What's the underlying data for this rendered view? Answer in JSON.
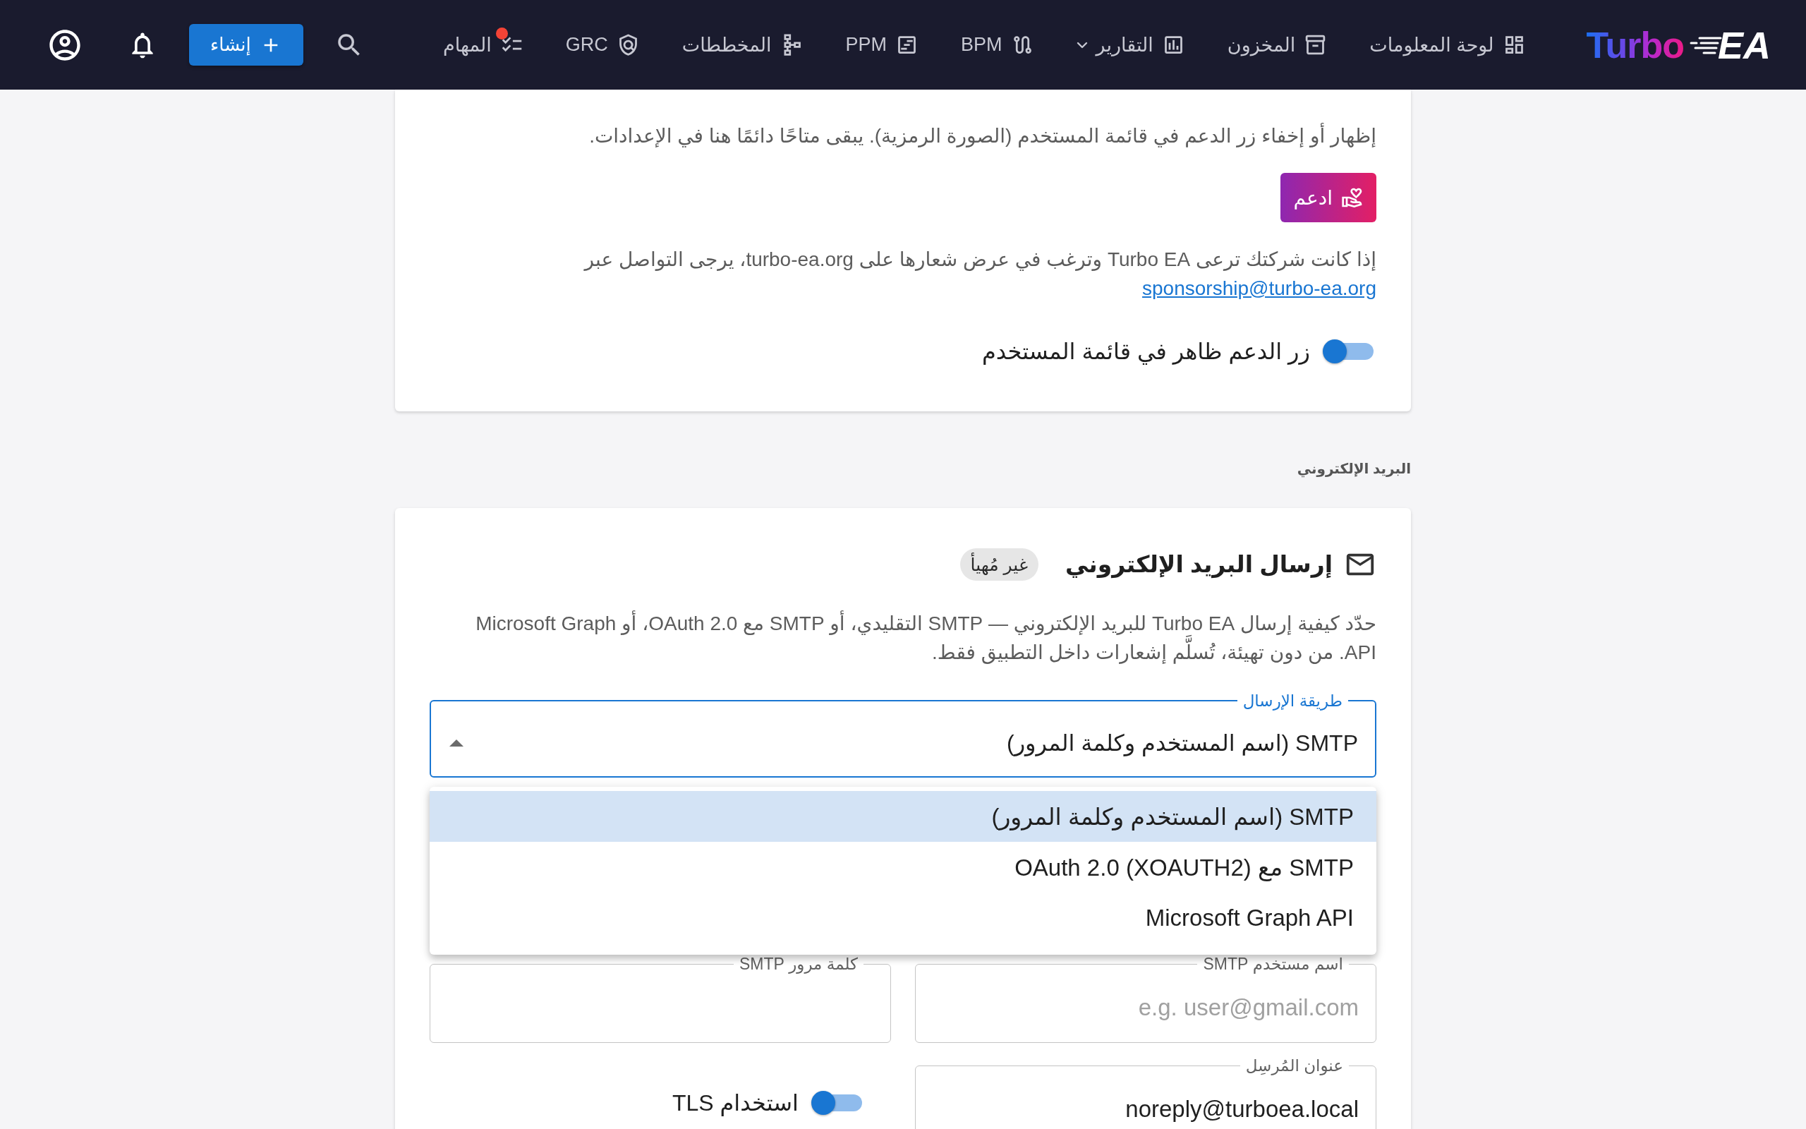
{
  "navbar": {
    "logo": {
      "text": "Turbo",
      "accent": "EA"
    },
    "items": [
      {
        "label": "لوحة المعلومات",
        "selected": false,
        "dropdown": false,
        "alert": false
      },
      {
        "label": "المخزون",
        "selected": false,
        "dropdown": false,
        "alert": false
      },
      {
        "label": "التقارير",
        "selected": false,
        "dropdown": true,
        "alert": false
      },
      {
        "label": "BPM",
        "selected": false,
        "dropdown": false,
        "alert": false
      },
      {
        "label": "PPM",
        "selected": false,
        "dropdown": false,
        "alert": false
      },
      {
        "label": "المخططات",
        "selected": false,
        "dropdown": false,
        "alert": false
      },
      {
        "label": "GRC",
        "selected": false,
        "dropdown": false,
        "alert": false
      },
      {
        "label": "المهام",
        "selected": false,
        "dropdown": false,
        "alert": true
      }
    ],
    "create_button": "إنشاء"
  },
  "support_card": {
    "description": "إظهار أو إخفاء زر الدعم في قائمة المستخدم (الصورة الرمزية). يبقى متاحًا دائمًا هنا في الإعدادات.",
    "support_button": "ادعم",
    "sponsor_text": "إذا كانت شركتك ترعى Turbo EA وترغب في عرض شعارها على turbo-ea.org، يرجى التواصل عبر",
    "sponsor_link": "sponsorship@turbo-ea.org",
    "toggle": {
      "label": "زر الدعم ظاهر في قائمة المستخدم",
      "on": true
    }
  },
  "email_section": {
    "heading": "البريد الإلكتروني",
    "title": "إرسال البريد الإلكتروني",
    "status_chip": "غير مُهيأ",
    "description": "حدّد كيفية إرسال Turbo EA للبريد الإلكتروني — SMTP التقليدي، أو SMTP مع OAuth 2.0، أو Microsoft Graph API. من دون تهيئة، تُسلَّم إشعارات داخل التطبيق فقط.",
    "method_select": {
      "label": "طريقة الإرسال",
      "value": "SMTP (اسم المستخدم وكلمة المرور)",
      "expanded": true
    },
    "method_options": [
      {
        "label": "SMTP (اسم المستخدم وكلمة المرور)",
        "selected": true
      },
      {
        "label": "SMTP مع OAuth 2.0 (XOAUTH2)",
        "selected": false
      },
      {
        "label": "Microsoft Graph API",
        "selected": false
      }
    ],
    "fields": [
      {
        "kind": "text",
        "label": "اسم مستخدم SMTP",
        "placeholder": "e.g. user@gmail.com"
      },
      {
        "kind": "text",
        "label": "كلمة مرور SMTP"
      },
      {
        "kind": "text",
        "label": "عنوان المُرسِل",
        "value": "noreply@turboea.local"
      },
      {
        "kind": "switch",
        "label": "استخدام TLS",
        "on": true
      }
    ]
  }
}
